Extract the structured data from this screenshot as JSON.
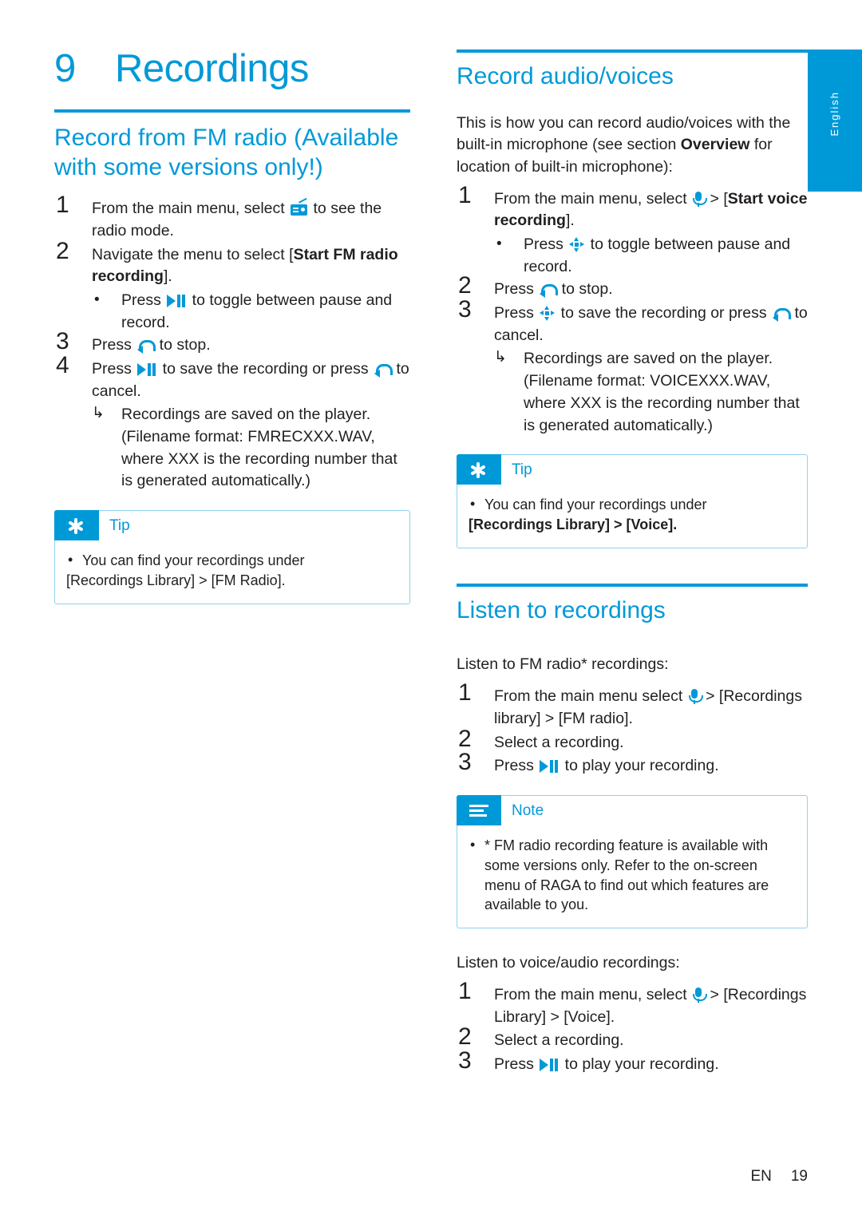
{
  "side_tab": {
    "language": "English"
  },
  "chapter": {
    "number": "9",
    "title": "Recordings"
  },
  "left": {
    "section_title": "Record from FM radio (Available with some versions only!)",
    "steps": [
      {
        "num": "1",
        "text_before": "From the main menu, select ",
        "icon": "fm-radio-icon",
        "text_after": " to see the radio mode."
      },
      {
        "num": "2",
        "text_before": "Navigate the menu to select [",
        "bold": "Start FM radio recording",
        "text_after": "]."
      },
      {
        "num": "3",
        "text_before": "Press ",
        "icon": "back-icon",
        "text_after": " to stop."
      },
      {
        "num": "4",
        "text_before": "Press ",
        "icon": "play-pause-icon",
        "text_after": " to save the recording or press ",
        "icon2": "back-icon",
        "text_after2": " to cancel."
      }
    ],
    "step2_bullet": {
      "text_before": "Press ",
      "icon": "play-pause-icon",
      "text_after": " to toggle between pause and record."
    },
    "step4_result": "Recordings are saved on the player. (Filename format: FMRECXXX.WAV, where XXX is the recording number that is generated automatically.)",
    "tip": {
      "label": "Tip",
      "line1": "You can find your recordings under",
      "line2": "[Recordings Library] > [FM Radio]."
    }
  },
  "right": {
    "section1_title": "Record audio/voices",
    "intro_part1": "This is how you can record audio/voices with the built-in microphone (see section ",
    "intro_bold": "Overview",
    "intro_part2": " for location of built-in microphone):",
    "steps": [
      {
        "num": "1",
        "text_before": "From the main menu, select ",
        "icon": "microphone-icon",
        "text_mid": " > [",
        "bold": "Start voice recording",
        "text_after": "]."
      },
      {
        "num": "2",
        "text_before": "Press ",
        "icon": "back-icon",
        "text_after": " to stop."
      },
      {
        "num": "3",
        "text_before": "Press ",
        "icon": "navigation-pad-icon",
        "text_after": " to save the recording or press ",
        "icon2": "back-icon",
        "text_after2": " to cancel."
      }
    ],
    "step1_bullet": {
      "text_before": "Press ",
      "icon": "navigation-pad-icon",
      "text_after": " to toggle between pause and record."
    },
    "step3_result": "Recordings are saved on the player. (Filename format: VOICEXXX.WAV, where XXX is the recording number that is generated automatically.)",
    "tip": {
      "label": "Tip",
      "line1": "You can find your recordings under",
      "line2": "[Recordings Library] > [Voice]."
    },
    "section2_title": "Listen to recordings",
    "fm_intro": "Listen to FM radio* recordings:",
    "fm_steps": [
      {
        "num": "1",
        "text_before": "From the main menu select ",
        "icon": "microphone-icon",
        "text_after": " > [Recordings library] > [FM radio]."
      },
      {
        "num": "2",
        "text": "Select a recording."
      },
      {
        "num": "3",
        "text_before": "Press ",
        "icon": "play-pause-icon",
        "text_after": " to play your recording."
      }
    ],
    "note": {
      "label": "Note",
      "text": "* FM radio recording feature is available with some versions only. Refer to the on-screen menu of RAGA to find out which features are available to you."
    },
    "voice_intro": "Listen to voice/audio recordings:",
    "voice_steps": [
      {
        "num": "1",
        "text_before": "From the main menu, select ",
        "icon": "microphone-icon",
        "text_after": " > [Recordings Library] > [Voice]."
      },
      {
        "num": "2",
        "text": "Select a recording."
      },
      {
        "num": "3",
        "text_before": "Press ",
        "icon": "play-pause-icon",
        "text_after": " to play your recording."
      }
    ]
  },
  "footer": {
    "lang_code": "EN",
    "page_number": "19"
  },
  "colors": {
    "accent": "#0099d8",
    "text": "#231f20",
    "callout_border": "#8ed2ef"
  }
}
